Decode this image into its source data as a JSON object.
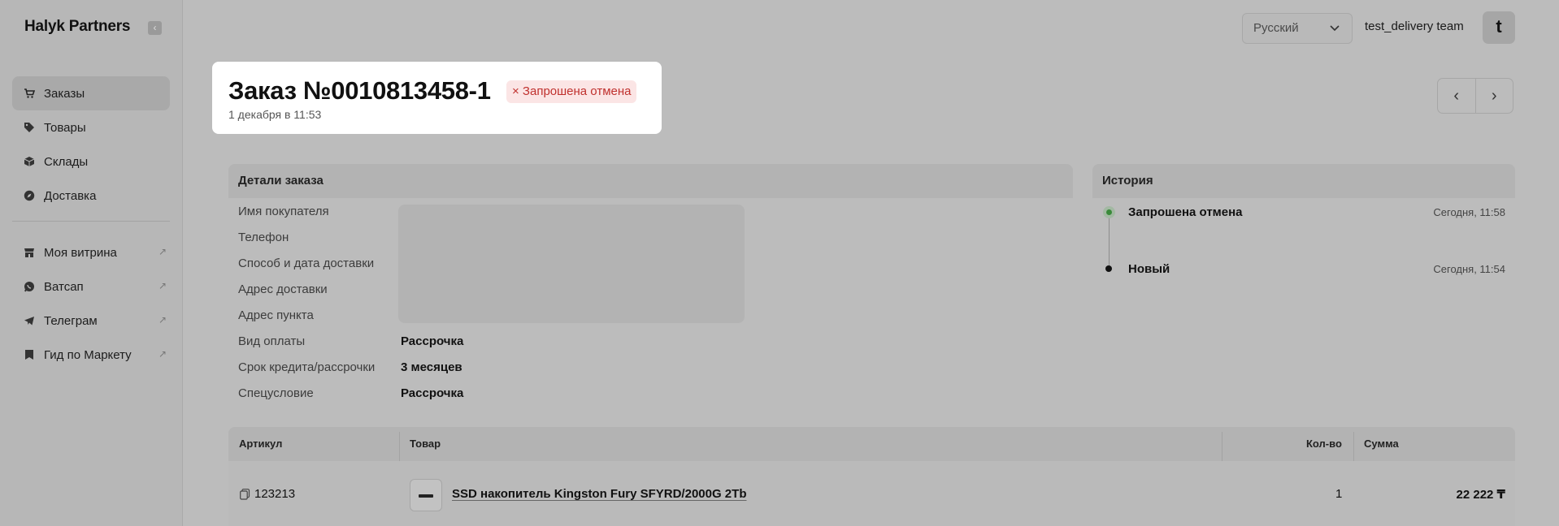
{
  "sidebar": {
    "logo": "Halyk Partners",
    "collapse_icon": "‹",
    "main_items": [
      {
        "label": "Заказы",
        "icon": "cart-icon",
        "active": true
      },
      {
        "label": "Товары",
        "icon": "tag-icon"
      },
      {
        "label": "Склады",
        "icon": "box-icon"
      },
      {
        "label": "Доставка",
        "icon": "compass-icon"
      }
    ],
    "external_items": [
      {
        "label": "Моя витрина",
        "icon": "storefront-icon"
      },
      {
        "label": "Ватсап",
        "icon": "whatsapp-icon"
      },
      {
        "label": "Телеграм",
        "icon": "telegram-icon"
      },
      {
        "label": "Гид по Маркету",
        "icon": "bookmark-icon"
      }
    ]
  },
  "header": {
    "language": "Русский",
    "user_name": "test_delivery team",
    "avatar_letter": "t"
  },
  "order": {
    "title": "Заказ №0010813458-1",
    "status": "× Запрошена отмена",
    "date": "1 декабря в 11:53"
  },
  "pager": {
    "prev": "‹",
    "next": "›"
  },
  "details": {
    "heading": "Детали заказа",
    "fields": [
      {
        "label": "Имя покупателя",
        "value": ""
      },
      {
        "label": "Телефон",
        "value": ""
      },
      {
        "label": "Способ и дата доставки",
        "value": ""
      },
      {
        "label": "Адрес доставки",
        "value": ""
      },
      {
        "label": "Адрес пункта",
        "value": ""
      },
      {
        "label": "Вид оплаты",
        "value": "Рассрочка"
      },
      {
        "label": "Срок кредита/рассрочки",
        "value": "3 месяцев"
      },
      {
        "label": "Спецусловие",
        "value": "Рассрочка"
      }
    ]
  },
  "history": {
    "heading": "История",
    "events": [
      {
        "title": "Запрошена отмена",
        "time": "Сегодня, 11:58"
      },
      {
        "title": "Новый",
        "time": "Сегодня, 11:54"
      }
    ]
  },
  "table": {
    "columns": [
      "Артикул",
      "Товар",
      "Кол-во",
      "Сумма"
    ],
    "rows": [
      {
        "sku": "123213",
        "product": "SSD накопитель Kingston Fury SFYRD/2000G 2Tb",
        "qty": "1",
        "sum": "22 222 ₸"
      }
    ]
  },
  "colors": {
    "status_text": "#c0312e",
    "status_bg": "#fbe5e5",
    "history_active": "#3a8a3a"
  }
}
